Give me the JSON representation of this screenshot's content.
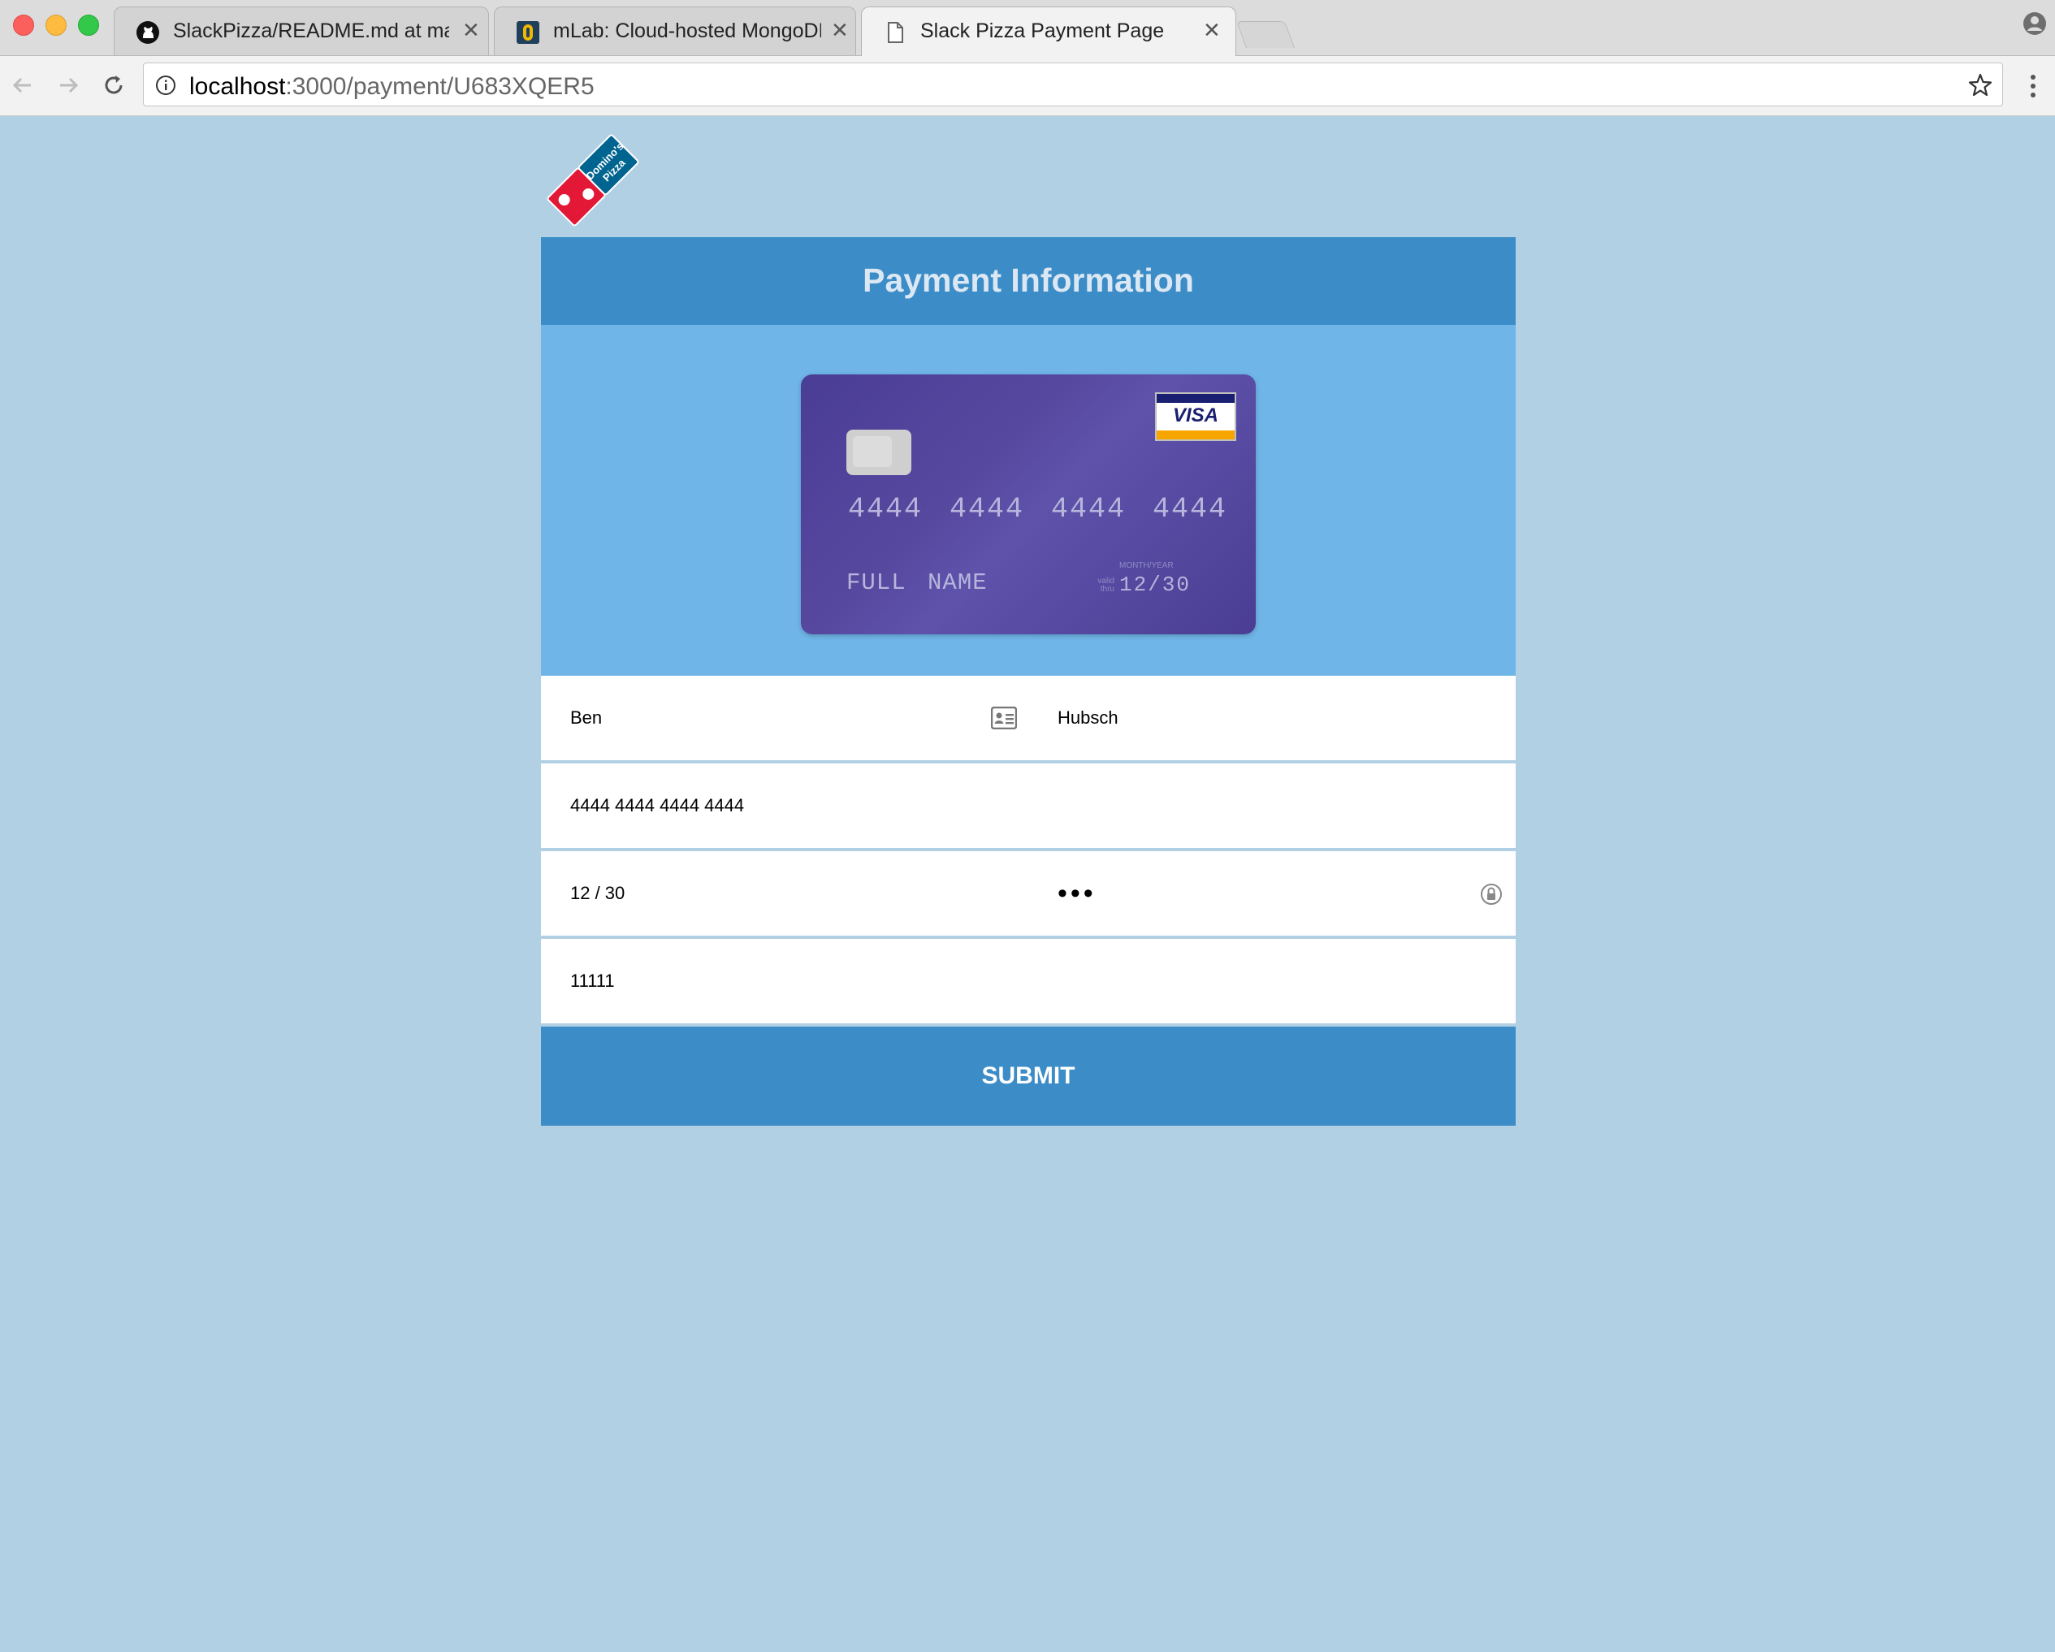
{
  "browser": {
    "tabs": [
      {
        "title": "SlackPizza/README.md at master",
        "icon": "github-icon",
        "active": false
      },
      {
        "title": "mLab: Cloud-hosted MongoDB",
        "icon": "mlab-icon",
        "active": false
      },
      {
        "title": "Slack Pizza Payment Page",
        "icon": "document-icon",
        "active": true
      }
    ],
    "url_host": "localhost",
    "url_path": ":3000/payment/U683XQER5"
  },
  "page": {
    "logo_text": "Domino's Pizza",
    "title": "Payment Information",
    "card_preview": {
      "number": "4444 4444 4444 4444",
      "name": "FULL NAME",
      "valid_label": "valid thru",
      "month_year_label": "MONTH/YEAR",
      "expiry": "12/30",
      "brand": "VISA"
    },
    "form": {
      "first_name": "Ben",
      "last_name": "Hubsch",
      "card_number": "4444 4444 4444 4444",
      "expiry": "12 / 30",
      "cvc": "111",
      "zip": "11111"
    },
    "submit_label": "SUBMIT"
  },
  "colors": {
    "background": "#b2d0e4",
    "header": "#3b8cc7",
    "card_area": "#6fb5e7",
    "card": "#4f4299"
  }
}
